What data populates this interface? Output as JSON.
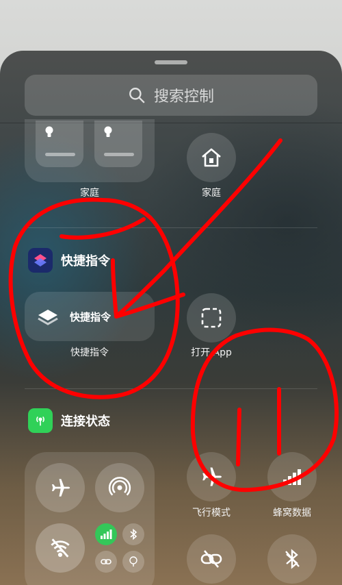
{
  "search": {
    "label": "搜索控制"
  },
  "home": {
    "group_label": "家庭",
    "button_label": "家庭"
  },
  "shortcuts": {
    "section_title": "快捷指令",
    "pill_label": "快捷指令",
    "control_label": "快捷指令",
    "open_app_label": "打开 App"
  },
  "connectivity": {
    "section_title": "连接状态",
    "airplane_label": "飞行模式",
    "cellular_label": "蜂窝数据"
  },
  "colors": {
    "annotation_red": "#ff0000",
    "cellular_green": "#34c759",
    "shortcuts_brand": "#1b2a6b"
  },
  "icons": [
    "search-icon",
    "lightbulb-icon",
    "house-icon",
    "shortcuts-icon",
    "layers-icon",
    "dashed-square-icon",
    "antenna-icon",
    "airplane-icon",
    "airdrop-icon",
    "wifi-off-icon",
    "cellular-icon",
    "bluetooth-icon",
    "link-icon",
    "tree-icon"
  ]
}
